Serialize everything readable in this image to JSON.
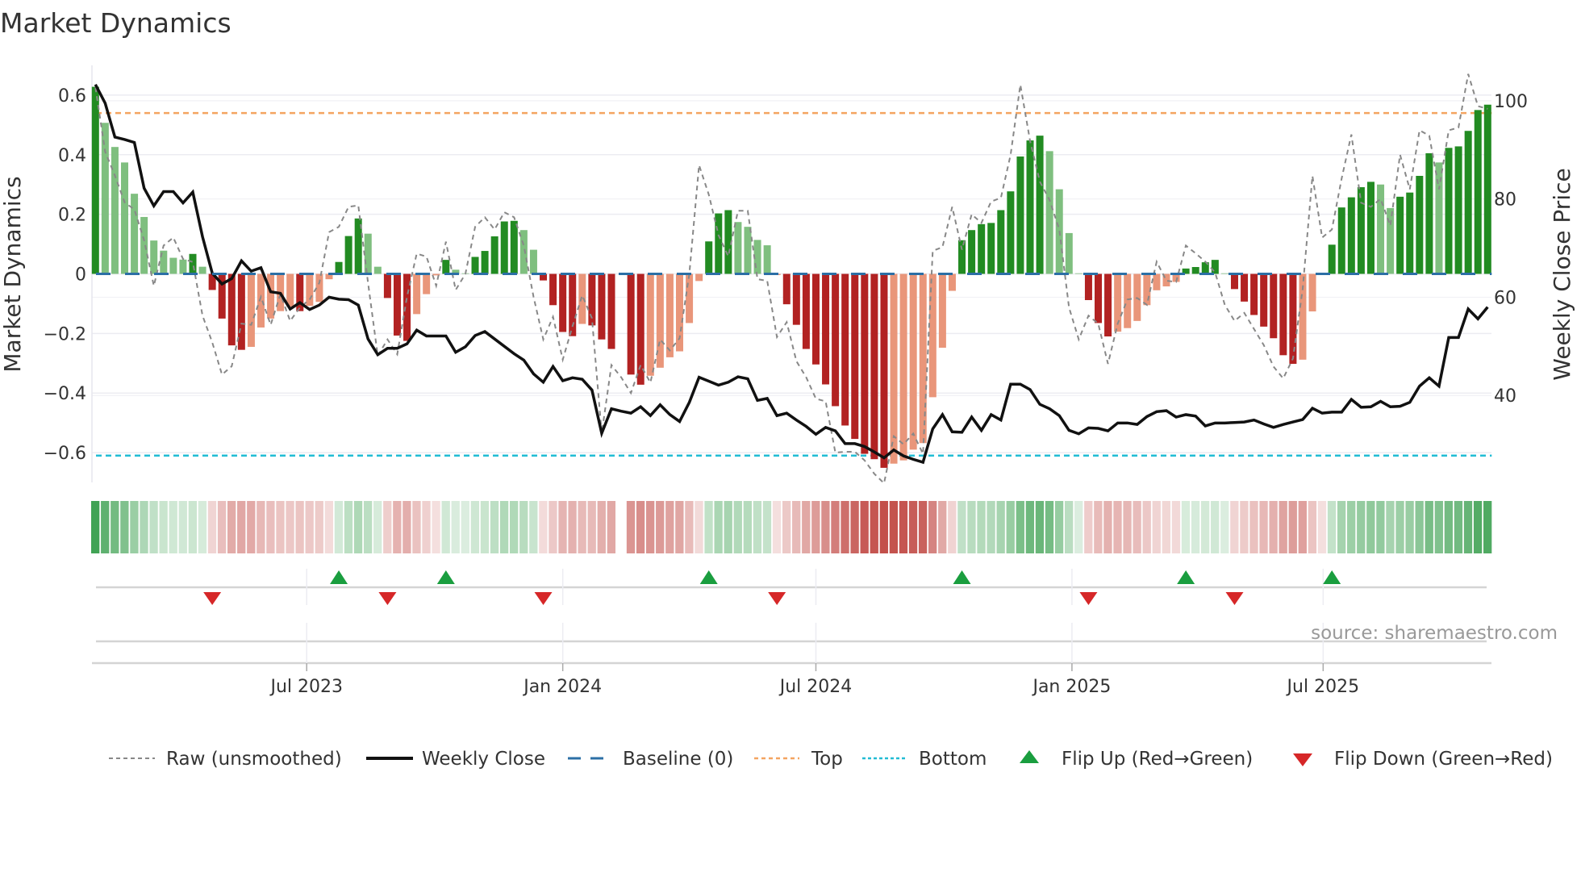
{
  "chart_data": {
    "type": "bar",
    "title": "Market Dynamics",
    "ylabel": "Market Dynamics",
    "y2label": "Weekly Close Price",
    "source": "source: sharemaestro.com",
    "frequency": "weekly",
    "ylim": [
      -0.7,
      0.7
    ],
    "y2lim": [
      22.3,
      107.2
    ],
    "yticks": [
      0.6,
      0.4,
      0.2,
      0,
      -0.2,
      -0.4,
      -0.6
    ],
    "ytick_labels": [
      "0.6",
      "0.4",
      "0.2",
      "0",
      "−0.2",
      "−0.4",
      "−0.6"
    ],
    "y2ticks": [
      100,
      80,
      60,
      40
    ],
    "y2tick_labels": [
      "100",
      "80",
      "60",
      "40"
    ],
    "xticks_week_index": [
      21.7,
      48.0,
      74.0,
      100.3,
      126.1
    ],
    "xtick_labels": [
      "Jul 2023",
      "Jan 2024",
      "Jul 2024",
      "Jan 2025",
      "Jul 2025"
    ],
    "top_threshold": 0.54,
    "bottom_threshold": -0.61,
    "baseline": 0,
    "grid": true,
    "legend_position": "bottom",
    "legend": [
      "Raw (unsmoothed)",
      "Weekly Close",
      "Baseline (0)",
      "Top",
      "Bottom",
      "Flip Up (Red→Green)",
      "Flip Down (Green→Red)"
    ],
    "colors": {
      "pos_strong": "#228b22",
      "pos_weak": "#7fbf7f",
      "neg_strong": "#b22222",
      "neg_weak": "#e9967a",
      "raw": "#888888",
      "close": "#111111",
      "baseline": "#2c6fa6",
      "top": "#f4a460",
      "bottom": "#22bcd4",
      "flip_up": "#1a9e3f",
      "flip_down": "#d62728"
    },
    "smoothed": [
      0.628,
      0.507,
      0.426,
      0.374,
      0.269,
      0.191,
      0.112,
      0.078,
      0.054,
      0.048,
      0.067,
      0.024,
      -0.054,
      -0.15,
      -0.24,
      -0.255,
      -0.245,
      -0.18,
      -0.15,
      -0.125,
      -0.11,
      -0.125,
      -0.107,
      -0.094,
      -0.018,
      0.04,
      0.127,
      0.186,
      0.135,
      0.024,
      -0.081,
      -0.207,
      -0.225,
      -0.135,
      -0.068,
      -0.005,
      0.047,
      0.014,
      0.002,
      0.057,
      0.077,
      0.126,
      0.176,
      0.178,
      0.147,
      0.081,
      -0.022,
      -0.105,
      -0.195,
      -0.209,
      -0.168,
      -0.173,
      -0.22,
      -0.252,
      null,
      -0.338,
      -0.372,
      -0.342,
      -0.315,
      -0.28,
      -0.26,
      -0.165,
      -0.024,
      0.109,
      0.203,
      0.214,
      0.174,
      0.158,
      0.114,
      0.096,
      -0.004,
      -0.102,
      -0.171,
      -0.252,
      -0.304,
      -0.371,
      -0.444,
      -0.509,
      -0.554,
      -0.604,
      -0.622,
      -0.651,
      -0.637,
      -0.626,
      -0.59,
      -0.568,
      -0.414,
      -0.248,
      -0.057,
      0.113,
      0.147,
      0.167,
      0.171,
      0.214,
      0.277,
      0.394,
      0.448,
      0.464,
      0.412,
      0.284,
      0.137,
      0.002,
      -0.088,
      -0.165,
      -0.21,
      -0.194,
      -0.182,
      -0.158,
      -0.105,
      -0.055,
      -0.042,
      -0.027,
      0.018,
      0.023,
      0.039,
      0.047,
      0.002,
      -0.051,
      -0.093,
      -0.138,
      -0.177,
      -0.216,
      -0.273,
      -0.302,
      -0.288,
      -0.126,
      -0.003,
      0.098,
      0.223,
      0.257,
      0.291,
      0.309,
      0.3,
      0.221,
      0.259,
      0.273,
      0.329,
      0.405,
      0.374,
      0.423,
      0.428,
      0.48,
      0.55,
      0.568
    ],
    "strength": "ddddddddddddddddddddddddddddddddddddddddddddddddddddddddddddddddddddddddddddddddddddddddddddddddddddddddddddddddddddddddddddddddddddddddddddddddd",
    "shade": [
      "d",
      "l",
      "l",
      "l",
      "l",
      "l",
      "l",
      "l",
      "l",
      "l",
      "d",
      "l",
      "d",
      "d",
      "d",
      "d",
      "l",
      "l",
      "l",
      "l",
      "l",
      "d",
      "l",
      "l",
      "l",
      "d",
      "d",
      "d",
      "l",
      "l",
      "d",
      "d",
      "d",
      "l",
      "l",
      "l",
      "d",
      "l",
      "l",
      "d",
      "d",
      "d",
      "d",
      "d",
      "l",
      "l",
      "d",
      "d",
      "d",
      "d",
      "l",
      "d",
      "d",
      "d",
      "d",
      "d",
      "d",
      "l",
      "l",
      "l",
      "l",
      "l",
      "l",
      "d",
      "d",
      "d",
      "l",
      "l",
      "l",
      "l",
      "l",
      "d",
      "d",
      "d",
      "d",
      "d",
      "d",
      "d",
      "d",
      "d",
      "d",
      "d",
      "l",
      "l",
      "l",
      "l",
      "l",
      "l",
      "l",
      "d",
      "d",
      "d",
      "d",
      "d",
      "d",
      "d",
      "d",
      "d",
      "l",
      "l",
      "l",
      "l",
      "d",
      "d",
      "d",
      "l",
      "l",
      "l",
      "l",
      "l",
      "l",
      "l",
      "d",
      "d",
      "d",
      "d",
      "l",
      "d",
      "d",
      "d",
      "d",
      "d",
      "d",
      "d",
      "l",
      "l",
      "l",
      "d",
      "d",
      "d",
      "d",
      "d",
      "l",
      "l",
      "d",
      "d",
      "d",
      "d",
      "l",
      "d",
      "d",
      "d",
      "d",
      "d"
    ],
    "raw": [
      0.626,
      0.41,
      0.33,
      0.24,
      0.216,
      0.113,
      -0.04,
      0.095,
      0.122,
      0.05,
      0.04,
      -0.14,
      -0.23,
      -0.338,
      -0.31,
      -0.167,
      -0.171,
      -0.077,
      -0.171,
      -0.068,
      -0.158,
      -0.113,
      -0.086,
      -0.03,
      0.14,
      0.158,
      0.225,
      0.23,
      -0.03,
      -0.275,
      -0.22,
      -0.27,
      -0.077,
      0.068,
      0.058,
      -0.04,
      0.108,
      -0.054,
      0,
      0.158,
      0.19,
      0.149,
      0.207,
      0.19,
      0.095,
      -0.077,
      -0.22,
      -0.144,
      -0.288,
      -0.176,
      -0.072,
      -0.149,
      -0.536,
      -0.306,
      -0.347,
      -0.4,
      -0.306,
      -0.365,
      -0.22,
      -0.257,
      -0.216,
      0,
      0.365,
      0.266,
      0.13,
      0.059,
      0.212,
      0.212,
      -0.018,
      -0.023,
      -0.212,
      -0.162,
      -0.293,
      -0.347,
      -0.419,
      -0.428,
      -0.6,
      -0.597,
      -0.597,
      -0.626,
      -0.671,
      -0.703,
      -0.545,
      -0.572,
      -0.536,
      -0.604,
      0.077,
      0.09,
      0.225,
      0.081,
      0.2,
      0.171,
      0.243,
      0.255,
      0.4,
      0.635,
      0.446,
      0.31,
      0.248,
      0.149,
      -0.113,
      -0.22,
      -0.14,
      -0.167,
      -0.302,
      -0.167,
      -0.086,
      -0.081,
      -0.104,
      0.041,
      -0.023,
      -0.027,
      0.095,
      0.069,
      0.041,
      0.005,
      -0.104,
      -0.158,
      -0.131,
      -0.185,
      -0.239,
      -0.311,
      -0.351,
      -0.284,
      -0.05,
      0.329,
      0.122,
      0.149,
      0.32,
      0.468,
      0.239,
      0.225,
      0.252,
      0.162,
      0.4,
      0.284,
      0.482,
      0.464,
      0.284,
      0.482,
      0.491,
      0.671,
      0.563,
      0.554
    ],
    "close": [
      103.3,
      99.5,
      92.6,
      92.1,
      91.5,
      82.2,
      78.6,
      81.5,
      81.5,
      79.2,
      81.4,
      72.3,
      64.9,
      62.7,
      63.8,
      67.4,
      65.3,
      66.0,
      61.1,
      60.8,
      57.6,
      58.9,
      57.5,
      58.4,
      60.0,
      59.6,
      59.5,
      58.4,
      51.5,
      48.3,
      49.6,
      49.6,
      50.5,
      53.3,
      52.1,
      52.1,
      52.1,
      48.8,
      49.9,
      52.2,
      53.0,
      51.5,
      50.0,
      48.5,
      47.2,
      44.4,
      42.7,
      45.9,
      43.0,
      43.6,
      43.3,
      41.1,
      32.3,
      37.3,
      36.8,
      36.4,
      37.7,
      35.9,
      38.1,
      36.1,
      34.7,
      38.6,
      43.7,
      42.9,
      42.1,
      42.7,
      43.8,
      43.4,
      39.0,
      39.4,
      35.9,
      36.4,
      35.0,
      33.7,
      32.1,
      33.5,
      32.8,
      30.2,
      30.2,
      29.6,
      28.5,
      27.3,
      28.9,
      27.7,
      27.0,
      26.4,
      33.2,
      36.1,
      32.6,
      32.5,
      35.6,
      32.9,
      36.1,
      35.0,
      42.3,
      42.3,
      41.2,
      38.2,
      37.3,
      35.9,
      32.9,
      32.2,
      33.4,
      33.3,
      32.8,
      34.4,
      34.4,
      34.1,
      35.7,
      36.7,
      36.9,
      35.6,
      36.1,
      35.8,
      33.8,
      34.4,
      34.4,
      34.5,
      34.6,
      35.0,
      34.2,
      33.5,
      34.1,
      34.6,
      35.1,
      37.4,
      36.4,
      36.6,
      36.6,
      39.2,
      37.6,
      37.7,
      38.8,
      37.7,
      37.8,
      38.6,
      41.9,
      43.6,
      41.9,
      51.8,
      51.8,
      57.6,
      55.6,
      58.0
    ]
  }
}
